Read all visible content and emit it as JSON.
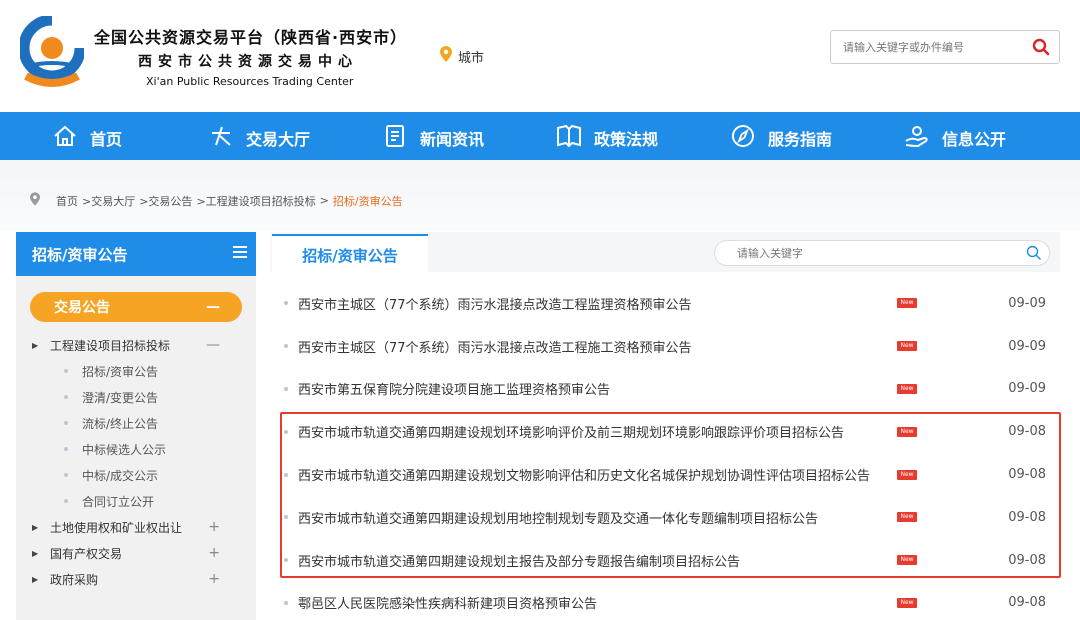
{
  "header": {
    "title_line1": "全国公共资源交易平台（陕西省·西安市）",
    "title_line2": "西安市公共资源交易中心",
    "title_line3": "Xi'an Public Resources Trading Center",
    "city_label": "城市",
    "search_placeholder": "请输入关键字或办件编号",
    "logo_colors": {
      "blue": "#1f6fbf",
      "orange": "#f08a1c"
    }
  },
  "nav": {
    "color": "#1f8ce8",
    "items": [
      {
        "label": "首页",
        "icon": "home-icon"
      },
      {
        "label": "交易大厅",
        "icon": "star-icon"
      },
      {
        "label": "新闻资讯",
        "icon": "document-icon"
      },
      {
        "label": "政策法规",
        "icon": "book-icon"
      },
      {
        "label": "服务指南",
        "icon": "compass-icon"
      },
      {
        "label": "信息公开",
        "icon": "hand-icon"
      }
    ]
  },
  "breadcrumb": {
    "items": [
      "首页",
      ">交易大厅",
      ">交易公告",
      ">工程建设项目招标投标",
      ">"
    ],
    "current": "招标/资审公告"
  },
  "sidebar": {
    "heading": "招标/资审公告",
    "section_pill": "交易公告",
    "section_toggle": "—",
    "groups": [
      {
        "label": "工程建设项目招标投标",
        "toggle": "—",
        "children": [
          "招标/资审公告",
          "澄清/变更公告",
          "流标/终止公告",
          "中标候选人公示",
          "中标/成交公示",
          "合同订立公开"
        ]
      },
      {
        "label": "土地使用权和矿业权出让",
        "toggle": "+",
        "children": []
      },
      {
        "label": "国有产权交易",
        "toggle": "+",
        "children": []
      },
      {
        "label": "政府采购",
        "toggle": "+",
        "children": []
      }
    ]
  },
  "main": {
    "tab_label": "招标/资审公告",
    "search_placeholder": "请输入关键字",
    "new_badge": "New",
    "rows": [
      {
        "title": "西安市主城区（77个系统）雨污水混接点改造工程监理资格预审公告",
        "date": "09-09"
      },
      {
        "title": "西安市主城区（77个系统）雨污水混接点改造工程施工资格预审公告",
        "date": "09-09"
      },
      {
        "title": "西安市第五保育院分院建设项目施工监理资格预审公告",
        "date": "09-09"
      },
      {
        "title": "西安市城市轨道交通第四期建设规划环境影响评价及前三期规划环境影响跟踪评价项目招标公告",
        "date": "09-08"
      },
      {
        "title": "西安市城市轨道交通第四期建设规划文物影响评估和历史文化名城保护规划协调性评估项目招标公告",
        "date": "09-08"
      },
      {
        "title": "西安市城市轨道交通第四期建设规划用地控制规划专题及交通一体化专题编制项目招标公告",
        "date": "09-08"
      },
      {
        "title": "西安市城市轨道交通第四期建设规划主报告及部分专题报告编制项目招标公告",
        "date": "09-08"
      },
      {
        "title": "鄠邑区人民医院感染性疾病科新建项目资格预审公告",
        "date": "09-08"
      }
    ]
  }
}
